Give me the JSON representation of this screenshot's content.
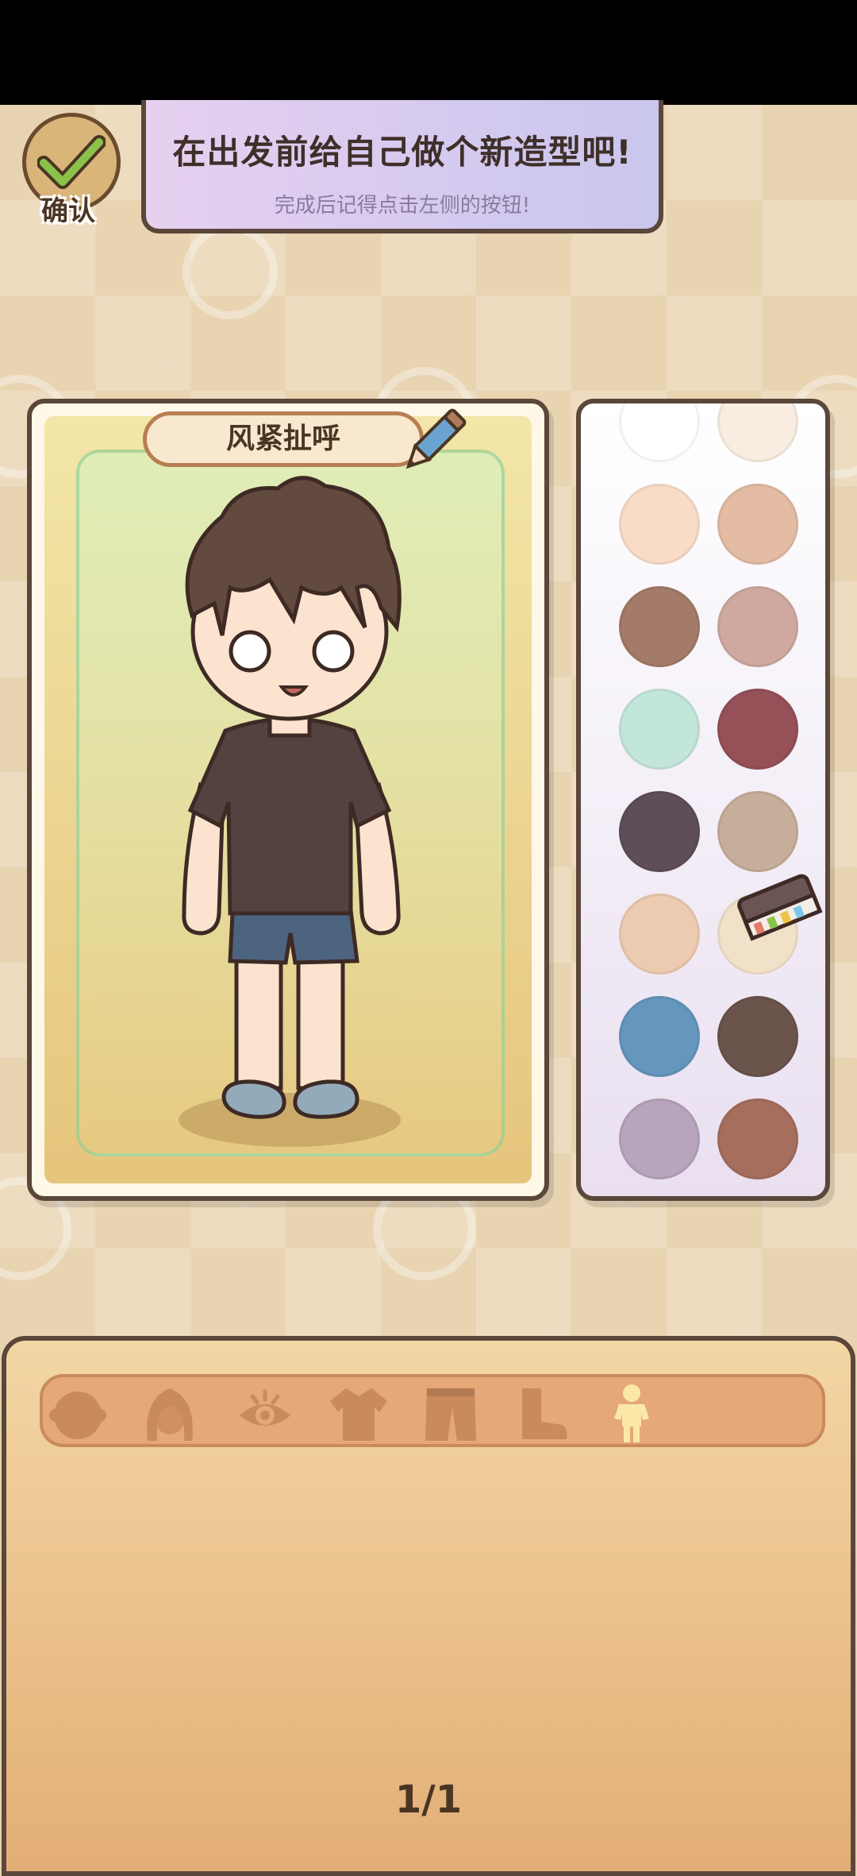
{
  "confirm": {
    "label": "确认"
  },
  "banner": {
    "title": "在出发前给自己做个新造型吧!",
    "subtitle": "完成后记得点击左侧的按钮!"
  },
  "character": {
    "name": "风紧扯呼"
  },
  "palette": {
    "colors": [
      "#ffffff",
      "#f8ede0",
      "#f8dcc8",
      "#e4bca3",
      "#a47b68",
      "#cfa9a0",
      "#c3e6da",
      "#955058",
      "#5e4e58",
      "#c7ae9a",
      "#eccbb0",
      "#f2e1c9",
      "#6596bd",
      "#6a544b",
      "#b7a4bd",
      "#a66e5c"
    ]
  },
  "tabs": [
    {
      "id": "face",
      "icon": "face-icon"
    },
    {
      "id": "hair",
      "icon": "hair-icon"
    },
    {
      "id": "eyes",
      "icon": "eye-icon"
    },
    {
      "id": "top",
      "icon": "shirt-icon"
    },
    {
      "id": "bottom",
      "icon": "pants-icon"
    },
    {
      "id": "shoes",
      "icon": "shoe-icon"
    },
    {
      "id": "body",
      "icon": "body-figure-icon",
      "selected": true
    }
  ],
  "pagination": {
    "text": "1/1"
  }
}
